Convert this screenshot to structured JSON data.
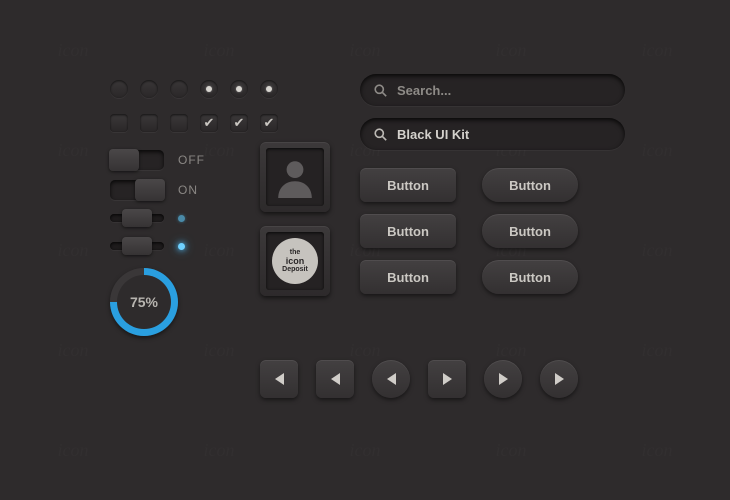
{
  "watermark": "the icon Deposit",
  "toggles": {
    "off_label": "OFF",
    "on_label": "ON"
  },
  "progress": {
    "label": "75%",
    "percent": 75
  },
  "search": {
    "placeholder": "Search...",
    "value": "Black UI Kit"
  },
  "buttons": {
    "b1": "Button",
    "b2": "Button",
    "b3": "Button",
    "b4": "Button",
    "b5": "Button",
    "b6": "Button"
  },
  "logo": {
    "line1": "the",
    "line2": "icon",
    "line3": "Deposit"
  },
  "colors": {
    "accent": "#2a9fe0"
  }
}
